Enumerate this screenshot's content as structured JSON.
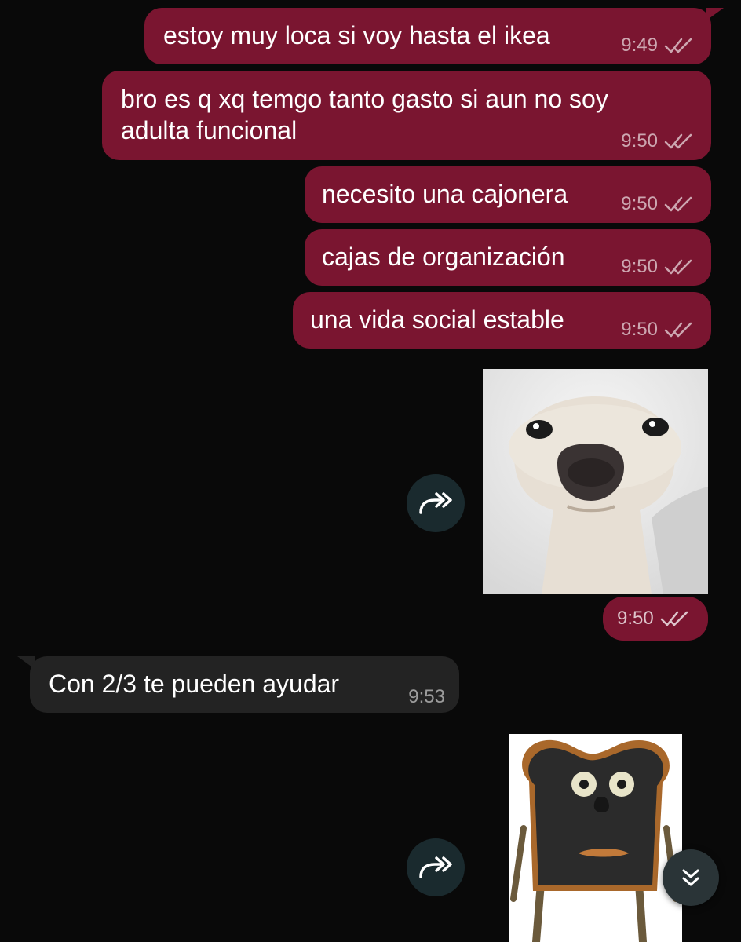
{
  "messages": [
    {
      "text": "estoy muy loca si voy hasta el ikea",
      "time": "9:49"
    },
    {
      "text_line1": "bro es q xq temgo tanto gasto si aun no soy",
      "text_line2": "adulta funcional",
      "time": "9:50"
    },
    {
      "text": "necesito una cajonera",
      "time": "9:50"
    },
    {
      "text": "cajas de organización",
      "time": "9:50"
    },
    {
      "text": "una vida social estable",
      "time": "9:50"
    },
    {
      "image": "dog-sticker",
      "time": "9:50"
    },
    {
      "text": "Con 2/3 te pueden ayudar",
      "time": "9:53"
    },
    {
      "image": "burnt-toast-sticker"
    }
  ],
  "colors": {
    "outgoing": "#7a1530",
    "incoming": "#232323",
    "background": "#090909"
  },
  "icons": {
    "read": "double-check-icon",
    "forward": "forward-icon",
    "scroll": "double-chevron-down-icon"
  }
}
